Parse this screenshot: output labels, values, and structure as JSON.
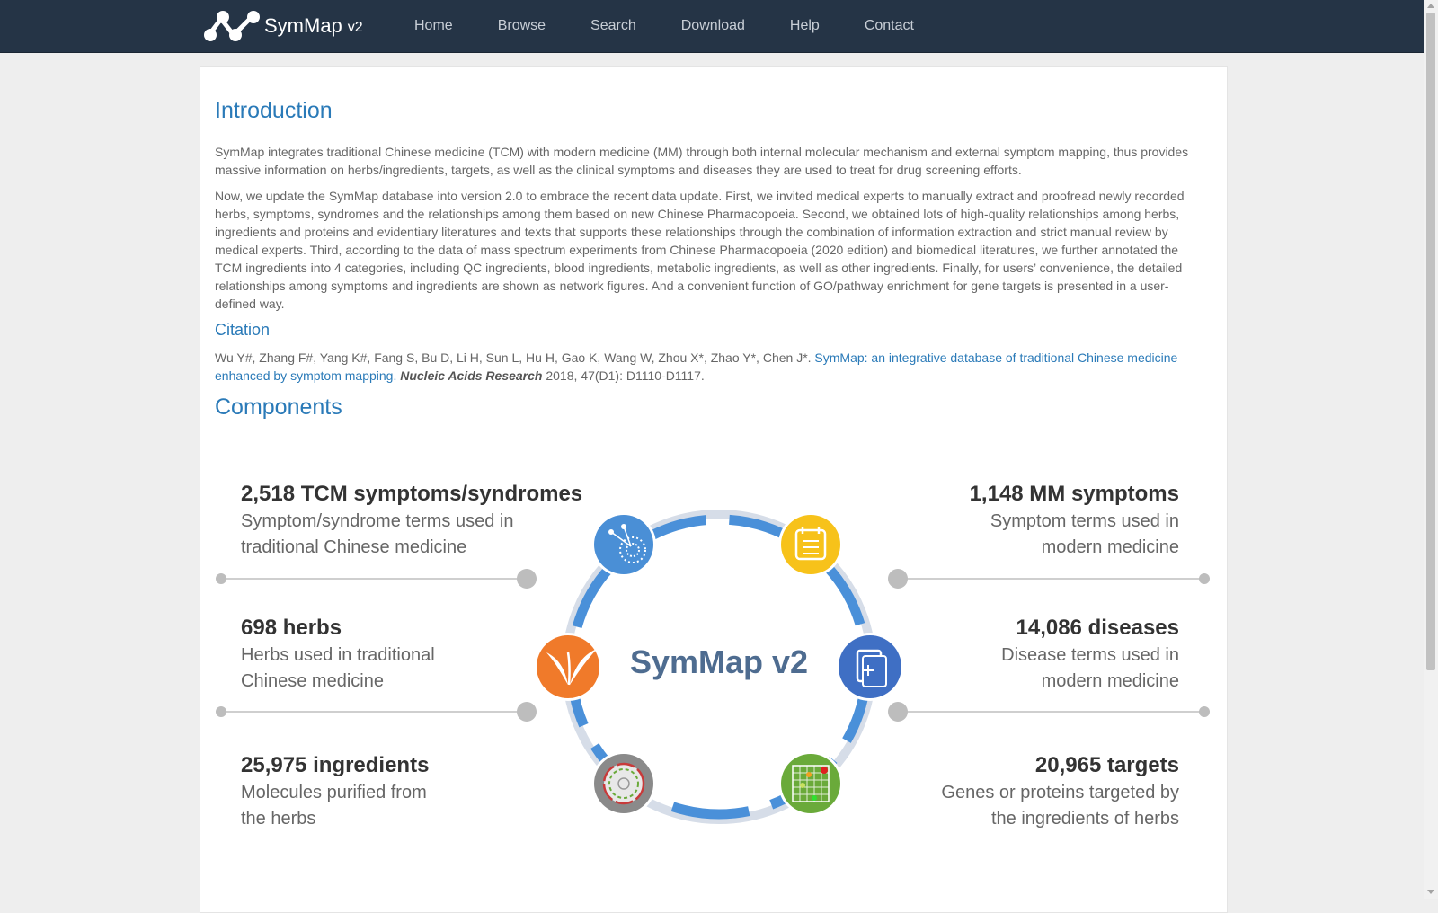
{
  "brand": {
    "name": "SymMap",
    "version": "v2"
  },
  "nav": [
    "Home",
    "Browse",
    "Search",
    "Download",
    "Help",
    "Contact"
  ],
  "intro": {
    "heading": "Introduction",
    "p1": "SymMap integrates traditional Chinese medicine (TCM) with modern medicine (MM) through both internal molecular mechanism and external symptom mapping, thus provides massive information on herbs/ingredients, targets, as well as the clinical symptoms and diseases they are used to treat for drug screening efforts.",
    "p2": "Now, we update the SymMap database into version 2.0 to embrace the recent data update. First, we invited medical experts to manually extract and proofread newly recorded herbs, symptoms, syndromes and the relationships among them based on new Chinese Pharmacopoeia. Second, we obtained lots of high-quality relationships among herbs, ingredients and proteins and evidentiary literatures and texts that supports these relationships through the combination of information extraction and strict manual review by medical experts. Third, according to the data of mass spectrum experiments from Chinese Pharmacopoeia (2020 edition) and biomedical literatures, we further annotated the TCM ingredients into 4 categories, including QC ingredients, blood ingredients, metabolic ingredients, as well as other ingredients. Finally, for users’ convenience, the detailed relationships among symptoms and ingredients are shown as network figures. And a convenient function of GO/pathway enrichment for gene targets is presented in a user-defined way."
  },
  "citation": {
    "heading": "Citation",
    "authors": "Wu Y#, Zhang F#, Yang K#, Fang S, Bu D, Li H, Sun L, Hu H, Gao K, Wang W, Zhou X*, Zhao Y*, Chen J*. ",
    "title_link": "SymMap: an integrative database of traditional Chinese medicine enhanced by symptom mapping.",
    "journal": "Nucleic Acids Research",
    "details": " 2018, 47(D1): D1110-D1117."
  },
  "components": {
    "heading": "Components",
    "center_title": "SymMap v2",
    "items": [
      {
        "num": "2,518 TCM symptoms/syndromes",
        "desc1": "Symptom/syndrome terms used in",
        "desc2": "traditional Chinese medicine"
      },
      {
        "num": "698 herbs",
        "desc1": "Herbs used in traditional",
        "desc2": "Chinese medicine"
      },
      {
        "num": "25,975 ingredients",
        "desc1": "Molecules purified from",
        "desc2": "the herbs"
      },
      {
        "num": "1,148 MM symptoms",
        "desc1": "Symptom terms used in",
        "desc2": "modern medicine"
      },
      {
        "num": "14,086 diseases",
        "desc1": "Disease terms used in",
        "desc2": "modern medicine"
      },
      {
        "num": "20,965 targets",
        "desc1": "Genes or proteins targeted by",
        "desc2": "the ingredients of herbs"
      }
    ]
  },
  "colors": {
    "navbar": "#253446",
    "heading_blue": "#2a7ab8",
    "ring_blue": "#4a90d9",
    "icon_tcm_symptom": "#4a8fd6",
    "icon_mm_symptom": "#f7c21a",
    "icon_herb": "#f07a2a",
    "icon_disease": "#3f6fc4",
    "icon_ingredient": "#8a8a8a",
    "icon_target": "#6aaa3a"
  }
}
